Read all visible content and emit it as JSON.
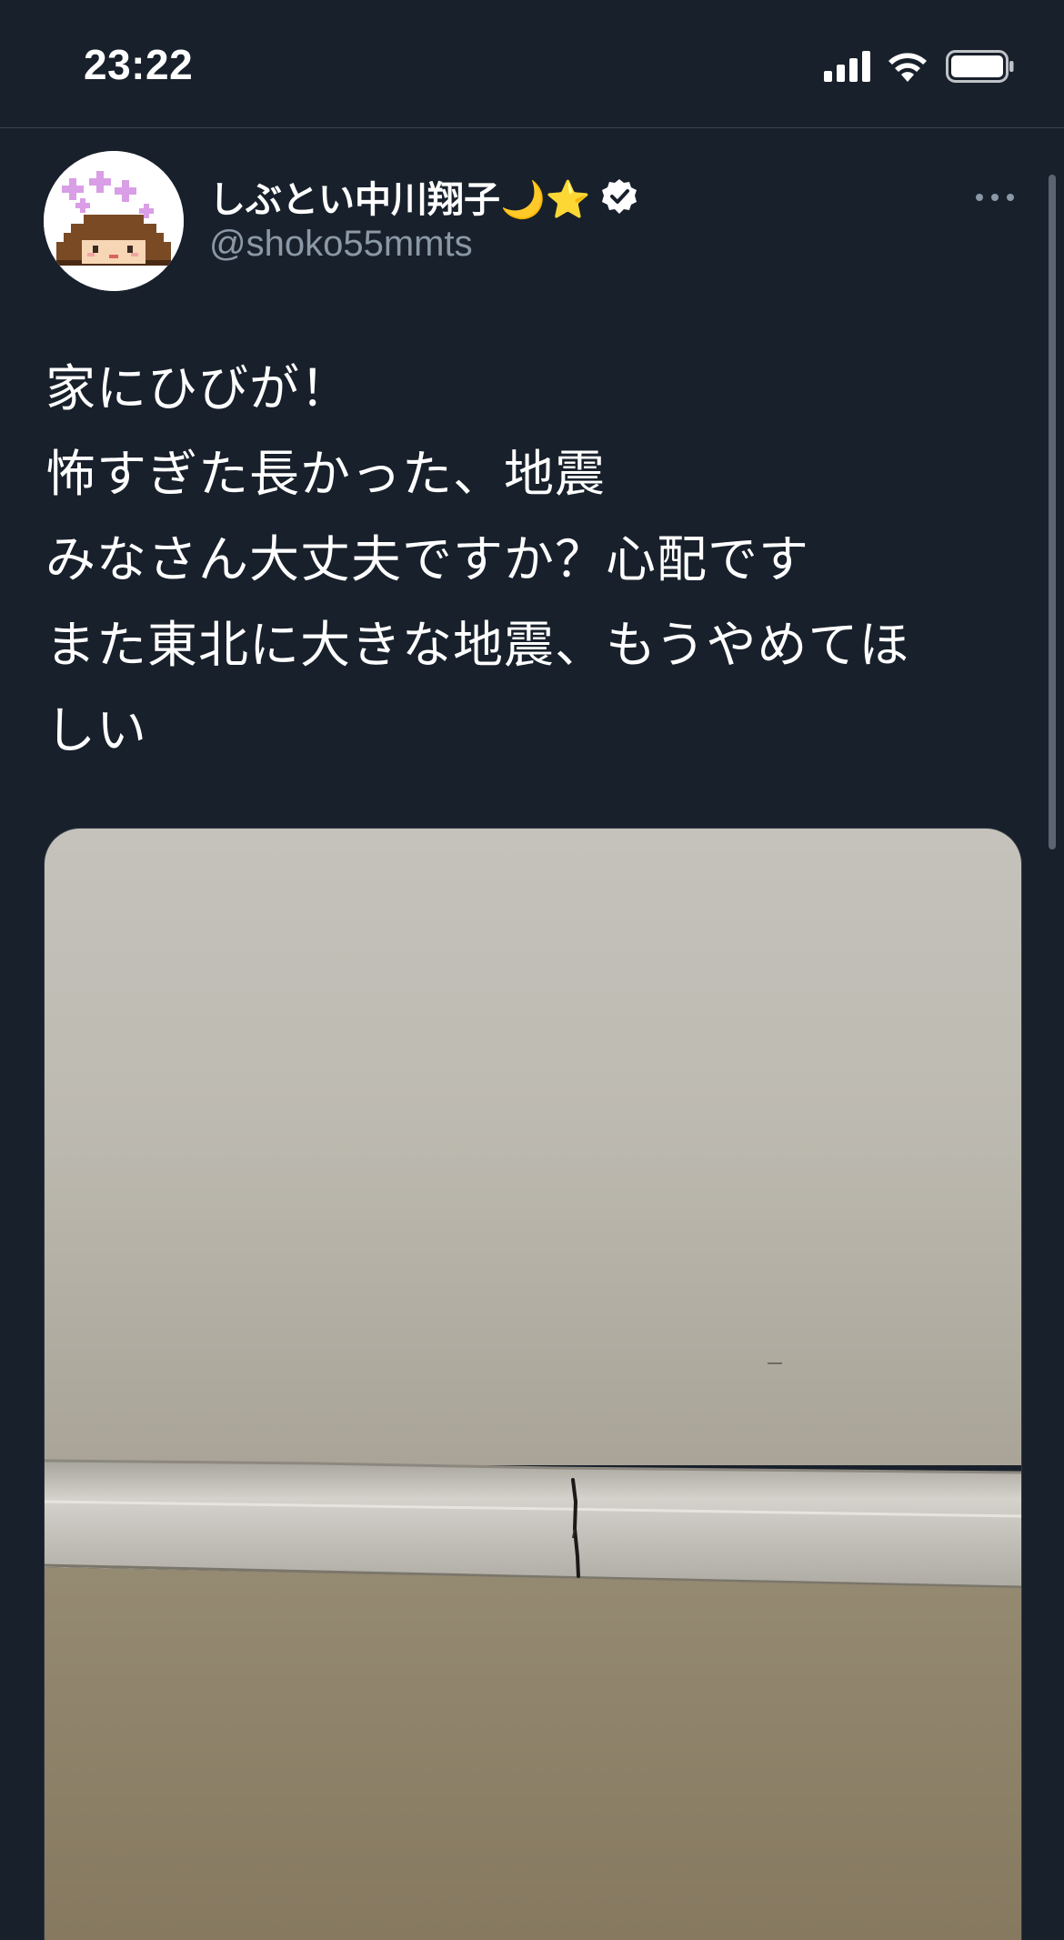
{
  "status_bar": {
    "time": "23:22",
    "signal_icon": "cellular-signal-icon",
    "wifi_icon": "wifi-icon",
    "battery_icon": "battery-icon"
  },
  "tweet": {
    "author": {
      "display_name": "しぶとい中川翔子🌙⭐",
      "handle": "@shoko55mmts",
      "verified": true,
      "avatar_icon": "pixel-art-avatar"
    },
    "more_icon": "more-options-icon",
    "text_lines": [
      "家にひびが！",
      "怖すぎた長かった、地震",
      "みなさん大丈夫ですか？心配です",
      "また東北に大きな地震、もうやめてほ",
      "しい"
    ],
    "media": {
      "kind": "photo",
      "subject": "wall-crack-photo"
    }
  },
  "colors": {
    "background": "#18202b",
    "text_primary": "#ffffff",
    "text_secondary": "#8b98a5",
    "divider": "#3a4451"
  }
}
